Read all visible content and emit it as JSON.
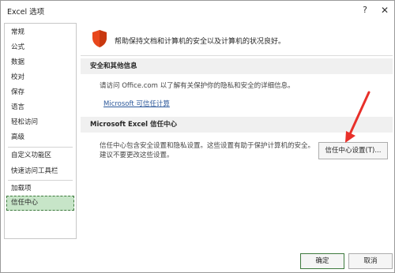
{
  "window": {
    "title": "Excel 选项",
    "help_glyph": "?",
    "close_glyph": "✕"
  },
  "sidebar": {
    "items": [
      {
        "label": "常规"
      },
      {
        "label": "公式"
      },
      {
        "label": "数据"
      },
      {
        "label": "校对"
      },
      {
        "label": "保存"
      },
      {
        "label": "语言"
      },
      {
        "label": "轻松访问"
      },
      {
        "label": "高级"
      },
      {
        "label": "自定义功能区"
      },
      {
        "label": "快速访问工具栏"
      },
      {
        "label": "加载项"
      },
      {
        "label": "信任中心"
      }
    ],
    "selected": "信任中心"
  },
  "main": {
    "header_text": "帮助保持文档和计算机的安全以及计算机的状况良好。",
    "shield_icon": "shield-icon",
    "security_section": {
      "heading": "安全和其他信息",
      "text": "请访问 Office.com 以了解有关保护你的隐私和安全的详细信息。",
      "link": "Microsoft 可信任计算"
    },
    "trust_center_section": {
      "heading": "Microsoft Excel 信任中心",
      "text_line1": "信任中心包含安全设置和隐私设置。这些设置有助于保护计算机的安全。",
      "text_line2": "建议不要更改这些设置。",
      "button_label": "信任中心设置(T)..."
    }
  },
  "footer": {
    "ok_label": "确定",
    "cancel_label": "取消"
  },
  "colors": {
    "shield": "#e8471c",
    "selected_nav_bg": "#c7e5c8",
    "link": "#2b579a",
    "annotation_arrow": "#e8302a"
  }
}
